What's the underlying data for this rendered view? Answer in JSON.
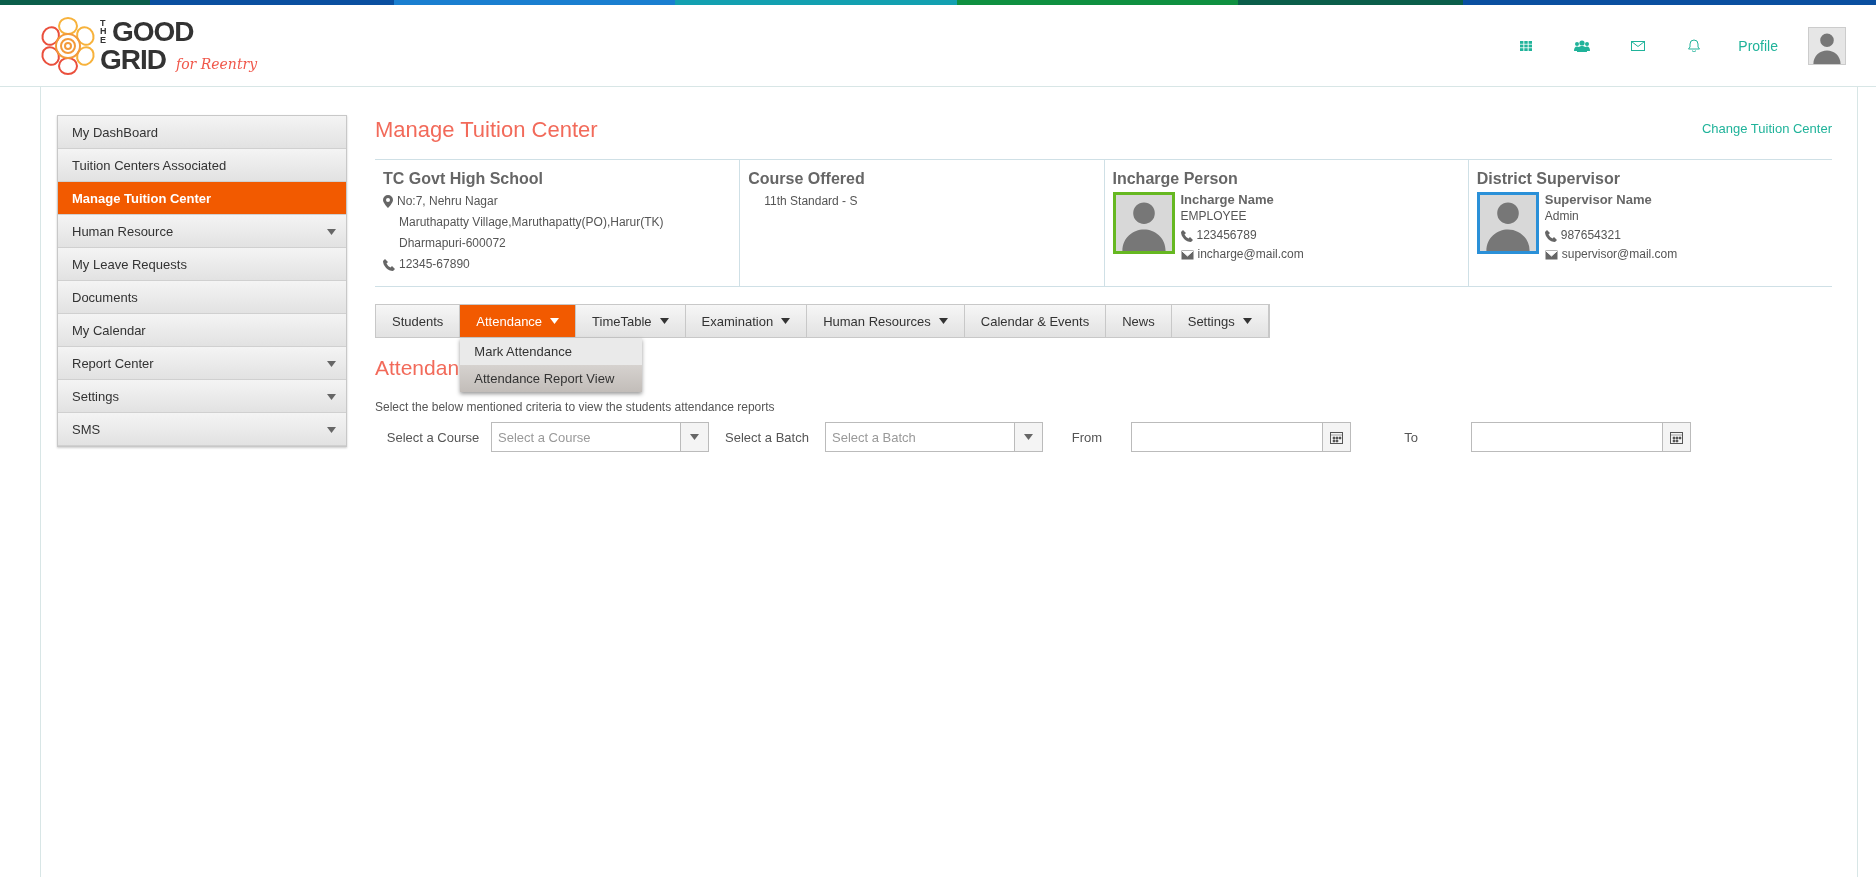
{
  "header": {
    "logo": {
      "line_1": "THE",
      "line_2": "GOOD",
      "line_3": "GRID",
      "tagline": "for Reentry"
    },
    "profile_link": "Profile"
  },
  "sidebar": {
    "items": [
      {
        "label": "My DashBoard",
        "selected": false,
        "has_submenu": false
      },
      {
        "label": "Tuition Centers Associated",
        "selected": false,
        "has_submenu": false
      },
      {
        "label": "Manage Tuition Center",
        "selected": true,
        "has_submenu": false
      },
      {
        "label": "Human Resource",
        "selected": false,
        "has_submenu": true
      },
      {
        "label": "My Leave Requests",
        "selected": false,
        "has_submenu": false
      },
      {
        "label": "Documents",
        "selected": false,
        "has_submenu": false
      },
      {
        "label": "My Calendar",
        "selected": false,
        "has_submenu": false
      },
      {
        "label": "Report Center",
        "selected": false,
        "has_submenu": true
      },
      {
        "label": "Settings",
        "selected": false,
        "has_submenu": true
      },
      {
        "label": "SMS",
        "selected": false,
        "has_submenu": true
      }
    ]
  },
  "page_title": "Manage Tuition Center",
  "change_link": "Change Tuition Center",
  "center": {
    "title": "TC Govt High School",
    "address": [
      "No:7, Nehru Nagar",
      "Maruthapatty Village,Maruthapatty(PO),Harur(TK)",
      "Dharmapuri-600072"
    ],
    "phone": "12345-67890"
  },
  "course": {
    "title": "Course Offered",
    "items": [
      "11th Standard - S"
    ]
  },
  "people": [
    {
      "title": "Incharge Person",
      "name": "Incharge Name",
      "role": "EMPLOYEE",
      "phone": "123456789",
      "email": "incharge@mail.com",
      "color": "#66b821"
    },
    {
      "title": "District Supervisor",
      "name": "Supervisor Name",
      "role": "Admin",
      "phone": "987654321",
      "email": "supervisor@mail.com",
      "color": "#2a90d8"
    }
  ],
  "tabs": [
    {
      "label": "Students",
      "selected": false,
      "has_menu": false
    },
    {
      "label": "Attendance",
      "selected": true,
      "has_menu": true
    },
    {
      "label": "TimeTable",
      "selected": false,
      "has_menu": true
    },
    {
      "label": "Examination",
      "selected": false,
      "has_menu": true
    },
    {
      "label": "Human Resources",
      "selected": false,
      "has_menu": true
    },
    {
      "label": "Calendar & Events",
      "selected": false,
      "has_menu": false
    },
    {
      "label": "News",
      "selected": false,
      "has_menu": false
    },
    {
      "label": "Settings",
      "selected": false,
      "has_menu": true
    }
  ],
  "dropdown": {
    "items": [
      {
        "label": "Mark Attendance",
        "selected": false
      },
      {
        "label": "Attendance Report View",
        "selected": true
      }
    ]
  },
  "section_title": "Attendan",
  "description": "Select the below mentioned criteria to view the students attendance reports",
  "filters": [
    {
      "kind": "select",
      "label": "Select a Course",
      "placeholder": "Select a Course"
    },
    {
      "kind": "select",
      "label": "Select a Batch",
      "placeholder": "Select a Batch"
    },
    {
      "kind": "date",
      "label": "From"
    },
    {
      "kind": "date",
      "label": "To"
    }
  ]
}
